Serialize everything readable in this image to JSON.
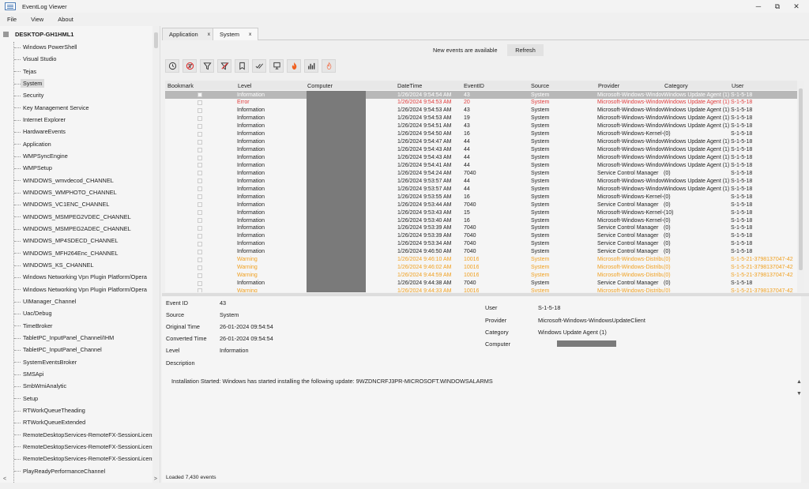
{
  "window": {
    "title": "EventLog Viewer",
    "minimize": "─",
    "restore": "⧉",
    "close": "✕"
  },
  "menu": [
    "File",
    "View",
    "About"
  ],
  "tree": {
    "root": "DESKTOP-GH1HML1",
    "selected_index": 3,
    "items": [
      "Windows PowerShell",
      "Visual Studio",
      "Tejas",
      "System",
      "Security",
      "Key Management Service",
      "Internet Explorer",
      "HardwareEvents",
      "Application",
      "WMPSyncEngine",
      "WMPSetup",
      "WINDOWS_wmvdecod_CHANNEL",
      "WINDOWS_WMPHOTO_CHANNEL",
      "WINDOWS_VC1ENC_CHANNEL",
      "WINDOWS_MSMPEG2VDEC_CHANNEL",
      "WINDOWS_MSMPEG2ADEC_CHANNEL",
      "WINDOWS_MP4SDECD_CHANNEL",
      "WINDOWS_MFH264Enc_CHANNEL",
      "WINDOWS_KS_CHANNEL",
      "Windows Networking Vpn Plugin Platform/Opera",
      "Windows Networking Vpn Plugin Platform/Opera",
      "UIManager_Channel",
      "Uac/Debug",
      "TimeBroker",
      "TabletPC_InputPanel_Channel/IHM",
      "TabletPC_InputPanel_Channel",
      "SystemEventsBroker",
      "SMSApi",
      "SmbWmiAnalytic",
      "Setup",
      "RTWorkQueueTheading",
      "RTWorkQueueExtended",
      "RemoteDesktopServices-RemoteFX-SessionLicens",
      "RemoteDesktopServices-RemoteFX-SessionLicens",
      "RemoteDesktopServices-RemoteFX-SessionLicens",
      "PlayReadyPerformanceChannel"
    ],
    "scroll_left": "<",
    "scroll_right": ">"
  },
  "tabs": [
    {
      "label": "Application",
      "close": "x"
    },
    {
      "label": "System",
      "close": "x"
    }
  ],
  "notification": {
    "text": "New events are available",
    "refresh": "Refresh"
  },
  "toolbar_icons": [
    "clock-icon",
    "no-filter-icon",
    "filter-icon",
    "clear-filter-icon",
    "bookmark-icon",
    "check-all-icon",
    "monitor-icon",
    "fire-icon",
    "chart-icon",
    "hot-icon"
  ],
  "grid": {
    "columns": [
      "Bookmark",
      "Level",
      "Computer",
      "DateTime",
      "EventID",
      "Source",
      "Provider",
      "Category",
      "User"
    ],
    "rows": [
      {
        "level": "Information",
        "datetime": "1/26/2024 9:54:54 AM",
        "id": "43",
        "source": "System",
        "provider": "Microsoft-Windows-WindowsUpdateClient",
        "category": "Windows Update Agent (1)",
        "user": "S-1-5-18",
        "kind": "sel"
      },
      {
        "level": "Error",
        "datetime": "1/26/2024 9:54:53 AM",
        "id": "20",
        "source": "System",
        "provider": "Microsoft-Windows-WindowsUpdateClient",
        "category": "Windows Update Agent (1)",
        "user": "S-1-5-18",
        "kind": "err"
      },
      {
        "level": "Information",
        "datetime": "1/26/2024 9:54:53 AM",
        "id": "43",
        "source": "System",
        "provider": "Microsoft-Windows-WindowsUpdateClient",
        "category": "Windows Update Agent (1)",
        "user": "S-1-5-18",
        "kind": ""
      },
      {
        "level": "Information",
        "datetime": "1/26/2024 9:54:53 AM",
        "id": "19",
        "source": "System",
        "provider": "Microsoft-Windows-WindowsUpdateClient",
        "category": "Windows Update Agent (1)",
        "user": "S-1-5-18",
        "kind": ""
      },
      {
        "level": "Information",
        "datetime": "1/26/2024 9:54:51 AM",
        "id": "43",
        "source": "System",
        "provider": "Microsoft-Windows-WindowsUpdateClient",
        "category": "Windows Update Agent (1)",
        "user": "S-1-5-18",
        "kind": ""
      },
      {
        "level": "Information",
        "datetime": "1/26/2024 9:54:50 AM",
        "id": "16",
        "source": "System",
        "provider": "Microsoft-Windows-Kernel-General",
        "category": "(0)",
        "user": "S-1-5-18",
        "kind": ""
      },
      {
        "level": "Information",
        "datetime": "1/26/2024 9:54:47 AM",
        "id": "44",
        "source": "System",
        "provider": "Microsoft-Windows-WindowsUpdateClient",
        "category": "Windows Update Agent (1)",
        "user": "S-1-5-18",
        "kind": ""
      },
      {
        "level": "Information",
        "datetime": "1/26/2024 9:54:43 AM",
        "id": "44",
        "source": "System",
        "provider": "Microsoft-Windows-WindowsUpdateClient",
        "category": "Windows Update Agent (1)",
        "user": "S-1-5-18",
        "kind": ""
      },
      {
        "level": "Information",
        "datetime": "1/26/2024 9:54:43 AM",
        "id": "44",
        "source": "System",
        "provider": "Microsoft-Windows-WindowsUpdateClient",
        "category": "Windows Update Agent (1)",
        "user": "S-1-5-18",
        "kind": ""
      },
      {
        "level": "Information",
        "datetime": "1/26/2024 9:54:41 AM",
        "id": "44",
        "source": "System",
        "provider": "Microsoft-Windows-WindowsUpdateClient",
        "category": "Windows Update Agent (1)",
        "user": "S-1-5-18",
        "kind": ""
      },
      {
        "level": "Information",
        "datetime": "1/26/2024 9:54:24 AM",
        "id": "7040",
        "source": "System",
        "provider": "Service Control Manager",
        "category": "(0)",
        "user": "S-1-5-18",
        "kind": ""
      },
      {
        "level": "Information",
        "datetime": "1/26/2024 9:53:57 AM",
        "id": "44",
        "source": "System",
        "provider": "Microsoft-Windows-WindowsUpdateClient",
        "category": "Windows Update Agent (1)",
        "user": "S-1-5-18",
        "kind": ""
      },
      {
        "level": "Information",
        "datetime": "1/26/2024 9:53:57 AM",
        "id": "44",
        "source": "System",
        "provider": "Microsoft-Windows-WindowsUpdateClient",
        "category": "Windows Update Agent (1)",
        "user": "S-1-5-18",
        "kind": ""
      },
      {
        "level": "Information",
        "datetime": "1/26/2024 9:53:55 AM",
        "id": "16",
        "source": "System",
        "provider": "Microsoft-Windows-Kernel-General",
        "category": "(0)",
        "user": "S-1-5-18",
        "kind": ""
      },
      {
        "level": "Information",
        "datetime": "1/26/2024 9:53:44 AM",
        "id": "7040",
        "source": "System",
        "provider": "Service Control Manager",
        "category": "(0)",
        "user": "S-1-5-18",
        "kind": ""
      },
      {
        "level": "Information",
        "datetime": "1/26/2024 9:53:43 AM",
        "id": "15",
        "source": "System",
        "provider": "Microsoft-Windows-Kernel-Boot",
        "category": "(10)",
        "user": "S-1-5-18",
        "kind": ""
      },
      {
        "level": "Information",
        "datetime": "1/26/2024 9:53:40 AM",
        "id": "16",
        "source": "System",
        "provider": "Microsoft-Windows-Kernel-General",
        "category": "(0)",
        "user": "S-1-5-18",
        "kind": ""
      },
      {
        "level": "Information",
        "datetime": "1/26/2024 9:53:39 AM",
        "id": "7040",
        "source": "System",
        "provider": "Service Control Manager",
        "category": "(0)",
        "user": "S-1-5-18",
        "kind": ""
      },
      {
        "level": "Information",
        "datetime": "1/26/2024 9:53:39 AM",
        "id": "7040",
        "source": "System",
        "provider": "Service Control Manager",
        "category": "(0)",
        "user": "S-1-5-18",
        "kind": ""
      },
      {
        "level": "Information",
        "datetime": "1/26/2024 9:53:34 AM",
        "id": "7040",
        "source": "System",
        "provider": "Service Control Manager",
        "category": "(0)",
        "user": "S-1-5-18",
        "kind": ""
      },
      {
        "level": "Information",
        "datetime": "1/26/2024 9:46:50 AM",
        "id": "7040",
        "source": "System",
        "provider": "Service Control Manager",
        "category": "(0)",
        "user": "S-1-5-18",
        "kind": ""
      },
      {
        "level": "Warning",
        "datetime": "1/26/2024 9:46:10 AM",
        "id": "10016",
        "source": "System",
        "provider": "Microsoft-Windows-DistributedCOM",
        "category": "(0)",
        "user": "S-1-5-21-3798137047-42",
        "kind": "warn"
      },
      {
        "level": "Warning",
        "datetime": "1/26/2024 9:46:02 AM",
        "id": "10016",
        "source": "System",
        "provider": "Microsoft-Windows-DistributedCOM",
        "category": "(0)",
        "user": "S-1-5-21-3798137047-42",
        "kind": "warn"
      },
      {
        "level": "Warning",
        "datetime": "1/26/2024 9:44:59 AM",
        "id": "10016",
        "source": "System",
        "provider": "Microsoft-Windows-DistributedCOM",
        "category": "(0)",
        "user": "S-1-5-21-3798137047-42",
        "kind": "warn"
      },
      {
        "level": "Information",
        "datetime": "1/26/2024 9:44:38 AM",
        "id": "7040",
        "source": "System",
        "provider": "Service Control Manager",
        "category": "(0)",
        "user": "S-1-5-18",
        "kind": ""
      },
      {
        "level": "Warning",
        "datetime": "1/26/2024 9:44:33 AM",
        "id": "10016",
        "source": "System",
        "provider": "Microsoft-Windows-DistributedCOM",
        "category": "(0)",
        "user": "S-1-5-21-3798137047-42",
        "kind": "warn"
      }
    ]
  },
  "details": {
    "event_id_label": "Event ID",
    "event_id": "43",
    "source_label": "Source",
    "source": "System",
    "original_time_label": "Original Time",
    "original_time": "26-01-2024 09:54:54",
    "converted_time_label": "Converted Time",
    "converted_time": "26-01-2024 09:54:54",
    "level_label": "Level",
    "level": "Information",
    "description_label": "Description",
    "user_label": "User",
    "user": "S-1-5-18",
    "provider_label": "Provider",
    "provider": "Microsoft-Windows-WindowsUpdateClient",
    "category_label": "Category",
    "category": "Windows Update Agent (1)",
    "computer_label": "Computer",
    "description": "Installation Started: Windows has started installing the following update: 9WZDNCRFJ3PR-MICROSOFT.WINDOWSALARMS",
    "scroll_up": "▲",
    "scroll_down": "▼"
  },
  "status": "Loaded 7,430 events",
  "colors": {
    "error": "#e03c3c",
    "warning": "#f0a020",
    "selected_row": "#b8b8b8"
  }
}
